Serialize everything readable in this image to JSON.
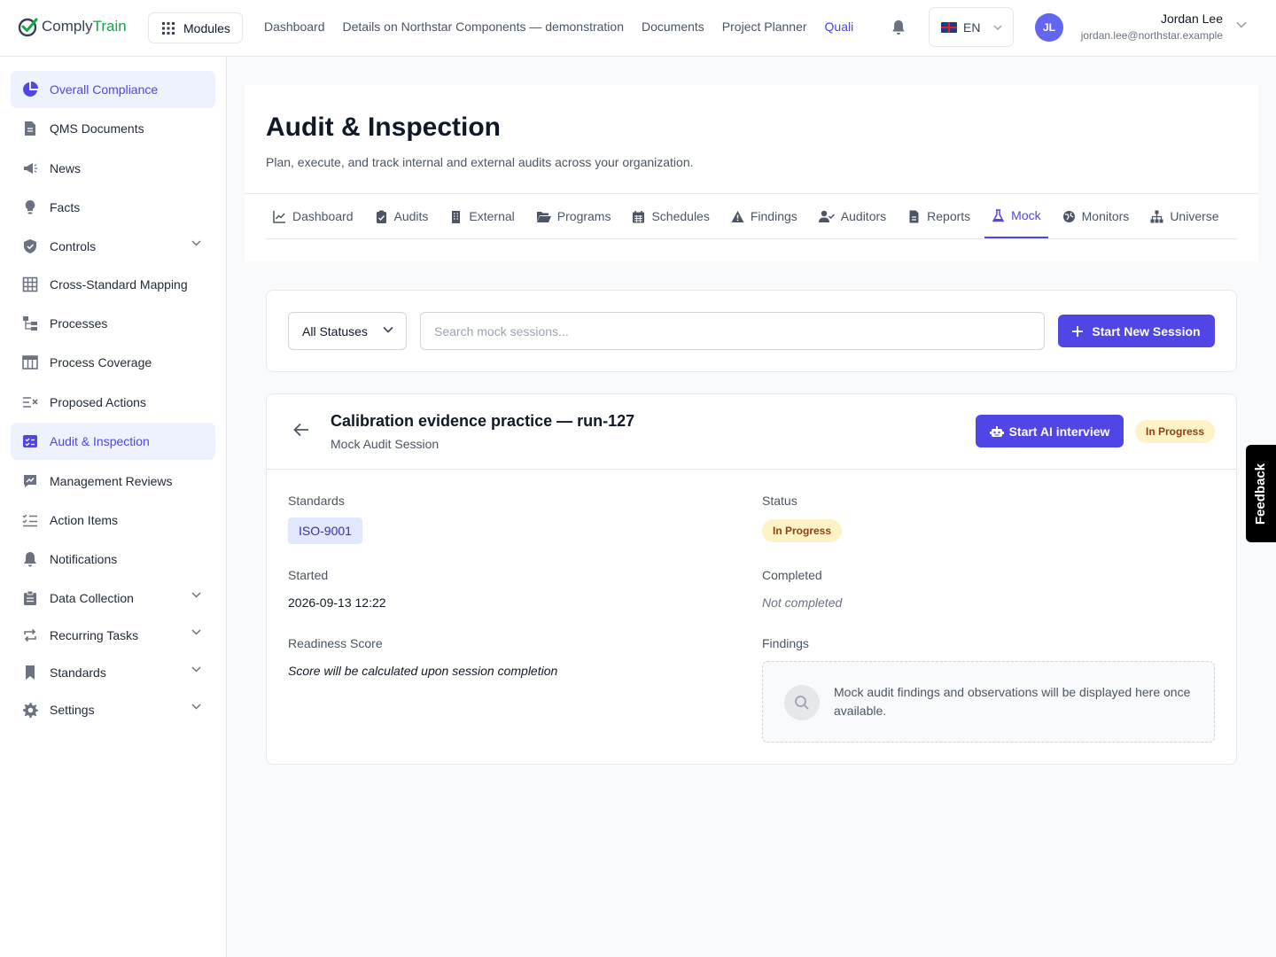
{
  "app": {
    "logo_part1": "Comply",
    "logo_part2": "Train",
    "modules_label": "Modules"
  },
  "topnav": {
    "items": [
      "Dashboard",
      "Details on Northstar Components — demonstration",
      "Documents",
      "Project Planner",
      "Quali"
    ],
    "active_index": 4
  },
  "language": {
    "code": "EN",
    "flag": "uk-flag"
  },
  "user": {
    "initials": "JL",
    "name": "Jordan Lee",
    "email": "jordan.lee@northstar.example"
  },
  "sidebar": {
    "items": [
      {
        "label": "Overall Compliance",
        "icon": "pie-chart-icon",
        "active": true,
        "expandable": false
      },
      {
        "label": "QMS Documents",
        "icon": "document-icon",
        "active": false,
        "expandable": false
      },
      {
        "label": "News",
        "icon": "megaphone-icon",
        "active": false,
        "expandable": false
      },
      {
        "label": "Facts",
        "icon": "lightbulb-icon",
        "active": false,
        "expandable": false
      },
      {
        "label": "Controls",
        "icon": "shield-icon",
        "active": false,
        "expandable": true
      },
      {
        "label": "Cross-Standard Mapping",
        "icon": "grid-icon",
        "active": false,
        "expandable": false
      },
      {
        "label": "Processes",
        "icon": "process-flow-icon",
        "active": false,
        "expandable": false
      },
      {
        "label": "Process Coverage",
        "icon": "table-icon",
        "active": false,
        "expandable": false
      },
      {
        "label": "Proposed Actions",
        "icon": "list-x-icon",
        "active": false,
        "expandable": false
      },
      {
        "label": "Audit & Inspection",
        "icon": "audit-icon",
        "active": true,
        "expandable": false
      },
      {
        "label": "Management Reviews",
        "icon": "chart-comment-icon",
        "active": false,
        "expandable": false
      },
      {
        "label": "Action Items",
        "icon": "checklist-icon",
        "active": false,
        "expandable": false
      },
      {
        "label": "Notifications",
        "icon": "bell-icon",
        "active": false,
        "expandable": false
      },
      {
        "label": "Data Collection",
        "icon": "clipboard-icon",
        "active": false,
        "expandable": true
      },
      {
        "label": "Recurring Tasks",
        "icon": "repeat-icon",
        "active": false,
        "expandable": true
      },
      {
        "label": "Standards",
        "icon": "bookmark-icon",
        "active": false,
        "expandable": true
      },
      {
        "label": "Settings",
        "icon": "gear-icon",
        "active": false,
        "expandable": true
      }
    ]
  },
  "page": {
    "title": "Audit & Inspection",
    "subtitle": "Plan, execute, and track internal and external audits across your organization."
  },
  "tabs": {
    "items": [
      {
        "label": "Dashboard",
        "icon": "line-chart-icon"
      },
      {
        "label": "Audits",
        "icon": "clipboard-check-icon"
      },
      {
        "label": "External",
        "icon": "building-icon"
      },
      {
        "label": "Programs",
        "icon": "folder-open-icon"
      },
      {
        "label": "Schedules",
        "icon": "calendar-icon"
      },
      {
        "label": "Findings",
        "icon": "warning-icon"
      },
      {
        "label": "Auditors",
        "icon": "user-check-icon"
      },
      {
        "label": "Reports",
        "icon": "file-icon"
      },
      {
        "label": "Mock",
        "icon": "flask-icon"
      },
      {
        "label": "Monitors",
        "icon": "globe-icon"
      },
      {
        "label": "Universe",
        "icon": "sitemap-icon"
      }
    ],
    "active_index": 8
  },
  "filters": {
    "status_value": "All Statuses",
    "search_placeholder": "Search mock sessions...",
    "new_session_label": "Start New Session"
  },
  "session": {
    "title": "Calibration evidence practice — run-127",
    "subtitle": "Mock Audit Session",
    "ai_button_label": "Start AI interview",
    "status_badge": "In Progress",
    "labels": {
      "standards": "Standards",
      "status": "Status",
      "started": "Started",
      "completed": "Completed",
      "readiness": "Readiness Score",
      "findings": "Findings"
    },
    "standard": "ISO-9001",
    "status": "In Progress",
    "started": "2026-09-13 12:22",
    "completed": "Not completed",
    "readiness_note": "Score will be calculated upon session completion",
    "findings_placeholder": "Mock audit findings and observations will be displayed here once available."
  },
  "feedback_label": "Feedback",
  "colors": {
    "accent": "#4f46e5",
    "brand_green": "#16a34a",
    "badge_bg": "#fef3c7",
    "badge_text": "#92400e",
    "chip_bg": "#e0e7ff"
  }
}
